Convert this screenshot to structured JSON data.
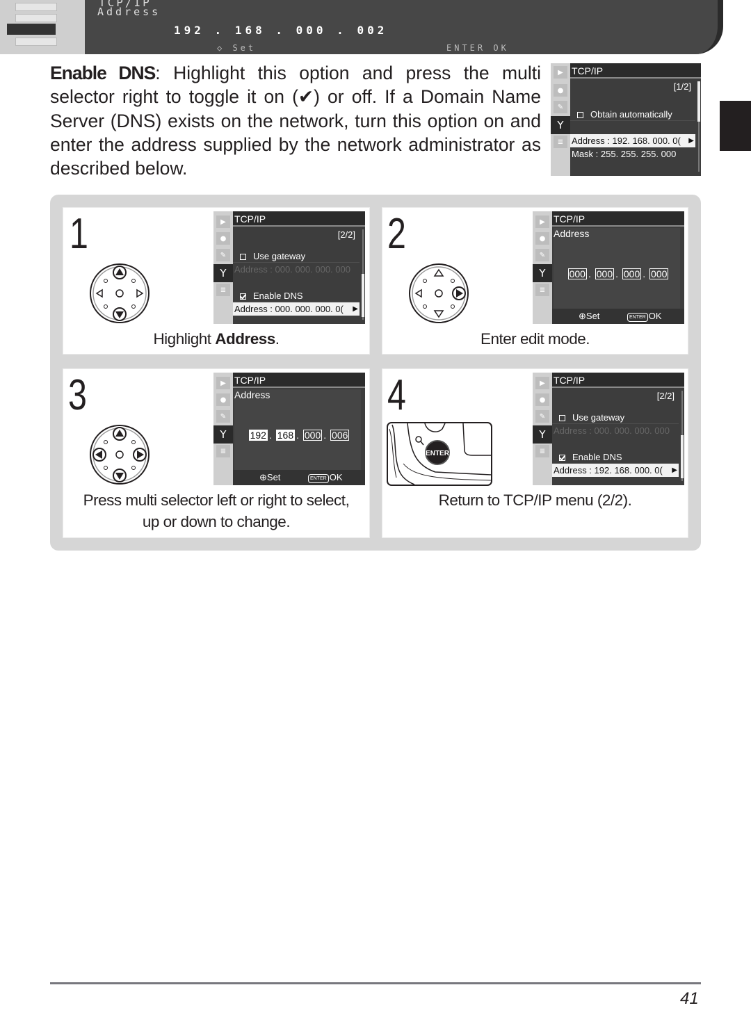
{
  "top_banner": {
    "menu_title": "TCP/IP",
    "field_label": "Address",
    "ip_octets": [
      "192",
      "168",
      "000",
      "002"
    ],
    "footer_set": "Set",
    "footer_enter": "ENTER",
    "footer_ok": "OK"
  },
  "paragraph": {
    "term": "Enable DNS",
    "text": ": Highlight this option and press the multi selector right to toggle it on (✔) or off.  If a Domain Name Server (DNS) exists on the network, turn this option on and enter the address supplied by the network administrator as described below."
  },
  "side_screen": {
    "menu_title": "TCP/IP",
    "page_indicator": "[1/2]",
    "option_label": "Obtain automatically",
    "option_checked": false,
    "rows": [
      {
        "label": "Address : 192. 168. 000. 0(",
        "highlighted": true
      },
      {
        "label": "Mask      : 255. 255. 255. 000",
        "highlighted": false
      }
    ]
  },
  "steps": [
    {
      "number": "1",
      "caption_prefix": "Highlight ",
      "caption_bold": "Address",
      "caption_suffix": ".",
      "selector_active": [
        "up",
        "down"
      ],
      "screen": {
        "menu_title": "TCP/IP",
        "page_indicator": "[2/2]",
        "gateway_label": "Use gateway",
        "gateway_checked": false,
        "gateway_address": "Address : 000. 000. 000. 000",
        "dns_label": "Enable DNS",
        "dns_checked": true,
        "dns_address": "Address : 000. 000. 000. 0("
      }
    },
    {
      "number": "2",
      "caption": "Enter edit mode.",
      "selector_active": [
        "right"
      ],
      "screen": {
        "menu_title": "TCP/IP",
        "field_label": "Address",
        "octets": [
          "000",
          "000",
          "000",
          "000"
        ],
        "footer_set": "Set",
        "footer_enter": "ENTER",
        "footer_ok": "OK"
      }
    },
    {
      "number": "3",
      "caption_line1": "Press multi selector left or right to select,",
      "caption_line2": "up or down to change.",
      "selector_active": [
        "up",
        "down",
        "left",
        "right"
      ],
      "screen": {
        "menu_title": "TCP/IP",
        "field_label": "Address",
        "octets": [
          "192",
          "168",
          "000",
          "006"
        ],
        "footer_set": "Set",
        "footer_enter": "ENTER",
        "footer_ok": "OK"
      }
    },
    {
      "number": "4",
      "caption": "Return to TCP/IP menu (2/2).",
      "button_label": "ENTER",
      "screen": {
        "menu_title": "TCP/IP",
        "page_indicator": "[2/2]",
        "gateway_label": "Use gateway",
        "gateway_checked": false,
        "gateway_address": "Address : 000. 000. 000. 000",
        "dns_label": "Enable DNS",
        "dns_checked": true,
        "dns_address": "Address : 192. 168. 000. 0("
      }
    }
  ],
  "page_number": "41",
  "colors": {
    "text": "#231f20",
    "lcd_background": "#3d3d3d",
    "frame_gray": "#d6d6d6",
    "chapter_tab": "#231f20"
  }
}
